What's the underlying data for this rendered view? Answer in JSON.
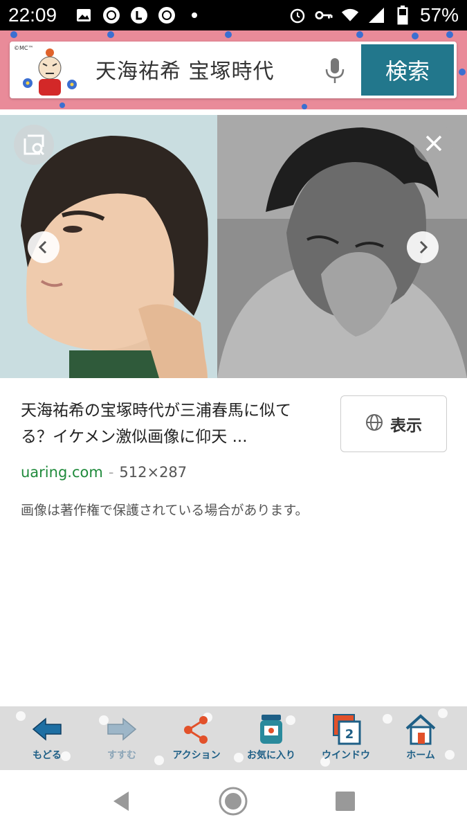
{
  "status_bar": {
    "time": "22:09",
    "battery": "57%",
    "left_icons": [
      "image-icon",
      "sync-icon",
      "line-l-icon",
      "sync-icon",
      "dot-icon"
    ],
    "right_icons": [
      "alarm-icon",
      "key-icon",
      "wifi-icon",
      "signal-icon",
      "battery-icon"
    ]
  },
  "header": {
    "logo_text": "©MC™",
    "search_query": "天海祐希 宝塚時代",
    "search_button": "検索",
    "mic_icon": "mic-icon"
  },
  "image_viewer": {
    "lens_icon": "image-search-icon",
    "close_icon": "close-icon",
    "prev_icon": "chevron-left-icon",
    "next_icon": "chevron-right-icon"
  },
  "result": {
    "title": "天海祐希の宝塚時代が三浦春馬に似てる？イケメン激似画像に仰天 ...",
    "view_button": "表示",
    "view_icon": "globe-icon",
    "domain": "uaring.com",
    "separator": "-",
    "dimensions": "512×287",
    "copyright_note": "画像は著作権で保護されている場合があります。"
  },
  "toolbar": {
    "items": [
      {
        "label": "もどる",
        "icon": "back-arrow-icon"
      },
      {
        "label": "すすむ",
        "icon": "forward-arrow-icon"
      },
      {
        "label": "アクション",
        "icon": "share-icon"
      },
      {
        "label": "お気に入り",
        "icon": "jar-bookmark-icon"
      },
      {
        "label": "ウインドウ",
        "icon": "windows-icon",
        "badge": "2"
      },
      {
        "label": "ホーム",
        "icon": "home-icon"
      }
    ]
  },
  "colors": {
    "header_pink": "#e98b99",
    "search_button": "#22778c",
    "domain_green": "#1f8a3b",
    "toolbar_blue": "#1e5f86"
  }
}
